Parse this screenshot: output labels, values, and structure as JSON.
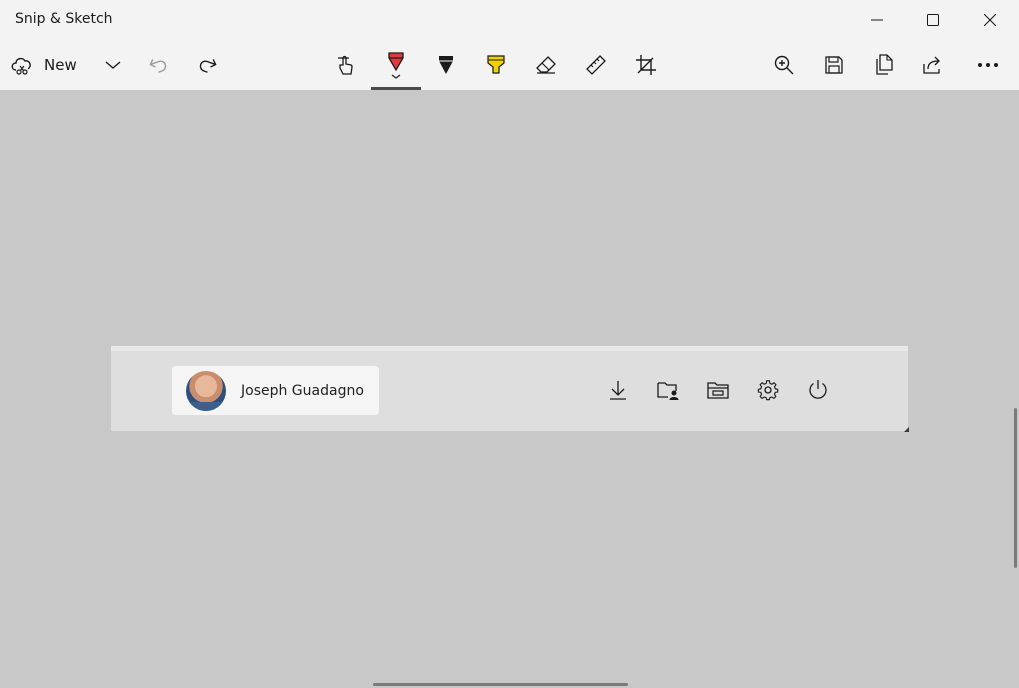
{
  "window": {
    "title": "Snip & Sketch",
    "controls": [
      "minimize",
      "maximize",
      "close"
    ]
  },
  "toolbar": {
    "new_label": "New",
    "tools": [
      "new-snip-icon",
      "chevron-down-icon",
      "undo-icon",
      "redo-icon",
      "touch-writing-icon",
      "ballpoint-pen-icon",
      "pencil-icon",
      "highlighter-icon",
      "eraser-icon",
      "ruler-icon",
      "crop-icon",
      "zoom-in-icon",
      "save-icon",
      "copy-icon",
      "share-icon",
      "more-icon"
    ],
    "selected_tool": "ballpoint-pen",
    "pen_color": "#e03a3a",
    "highlighter_color": "#f2d100"
  },
  "snip": {
    "user_name": "Joseph Guadagno",
    "icons": [
      "download-icon",
      "user-folder-icon",
      "file-explorer-icon",
      "settings-icon",
      "power-icon"
    ]
  },
  "colors": {
    "canvas_bg": "#c8c8c8",
    "chrome_bg": "#f3f3f3"
  }
}
